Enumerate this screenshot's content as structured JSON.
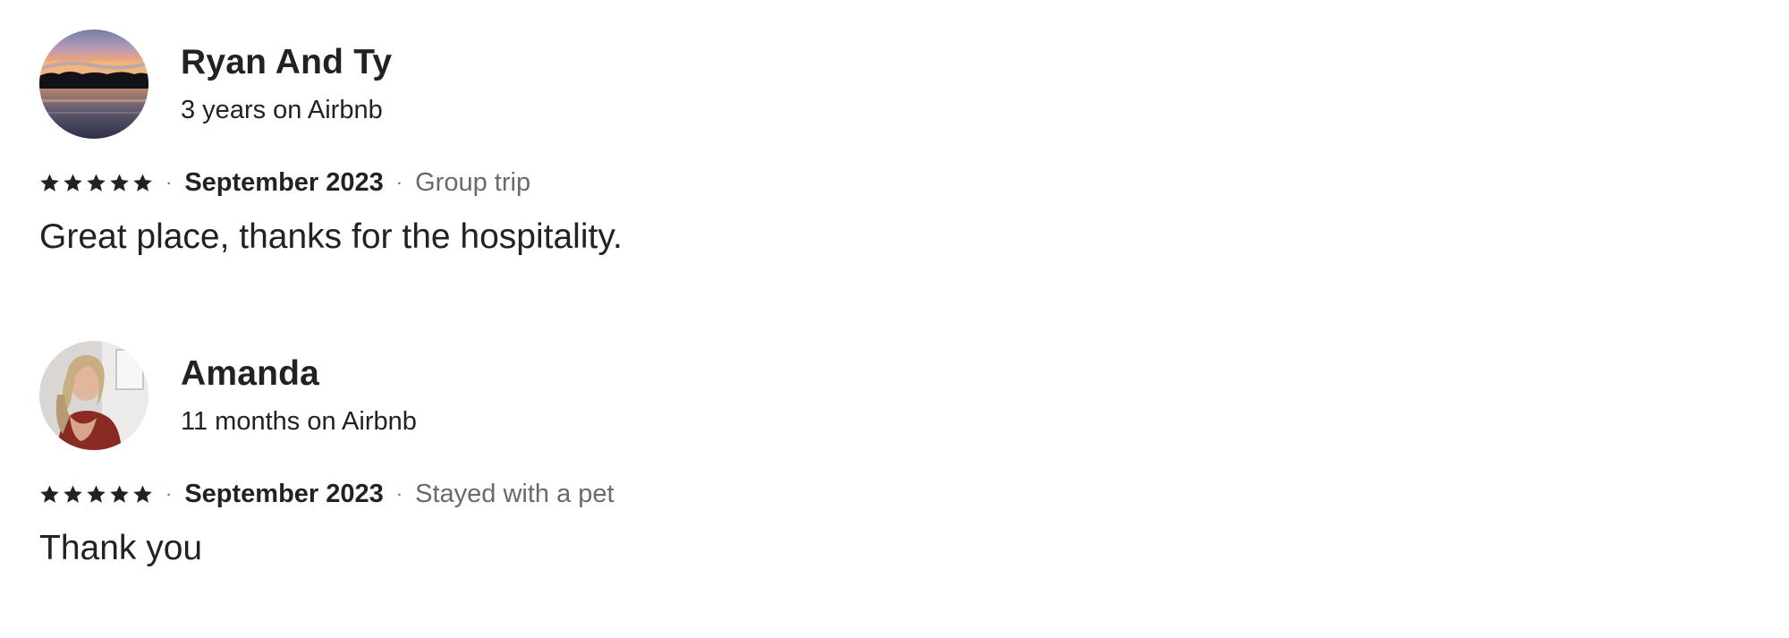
{
  "reviews": [
    {
      "name": "Ryan And Ty",
      "tenure": "3 years on Airbnb",
      "rating": 5,
      "separator": "·",
      "date": "September 2023",
      "trip_type": "Group trip",
      "text": "Great place, thanks for the hospitality.",
      "avatar_icon": "sunset-lake-photo"
    },
    {
      "name": "Amanda",
      "tenure": "11 months on Airbnb",
      "rating": 5,
      "separator": "·",
      "date": "September 2023",
      "trip_type": "Stayed with a pet",
      "text": "Thank you",
      "avatar_icon": "profile-photo"
    }
  ],
  "colors": {
    "text_primary": "#222222",
    "text_secondary": "#6a6a6a",
    "star": "#222222"
  }
}
